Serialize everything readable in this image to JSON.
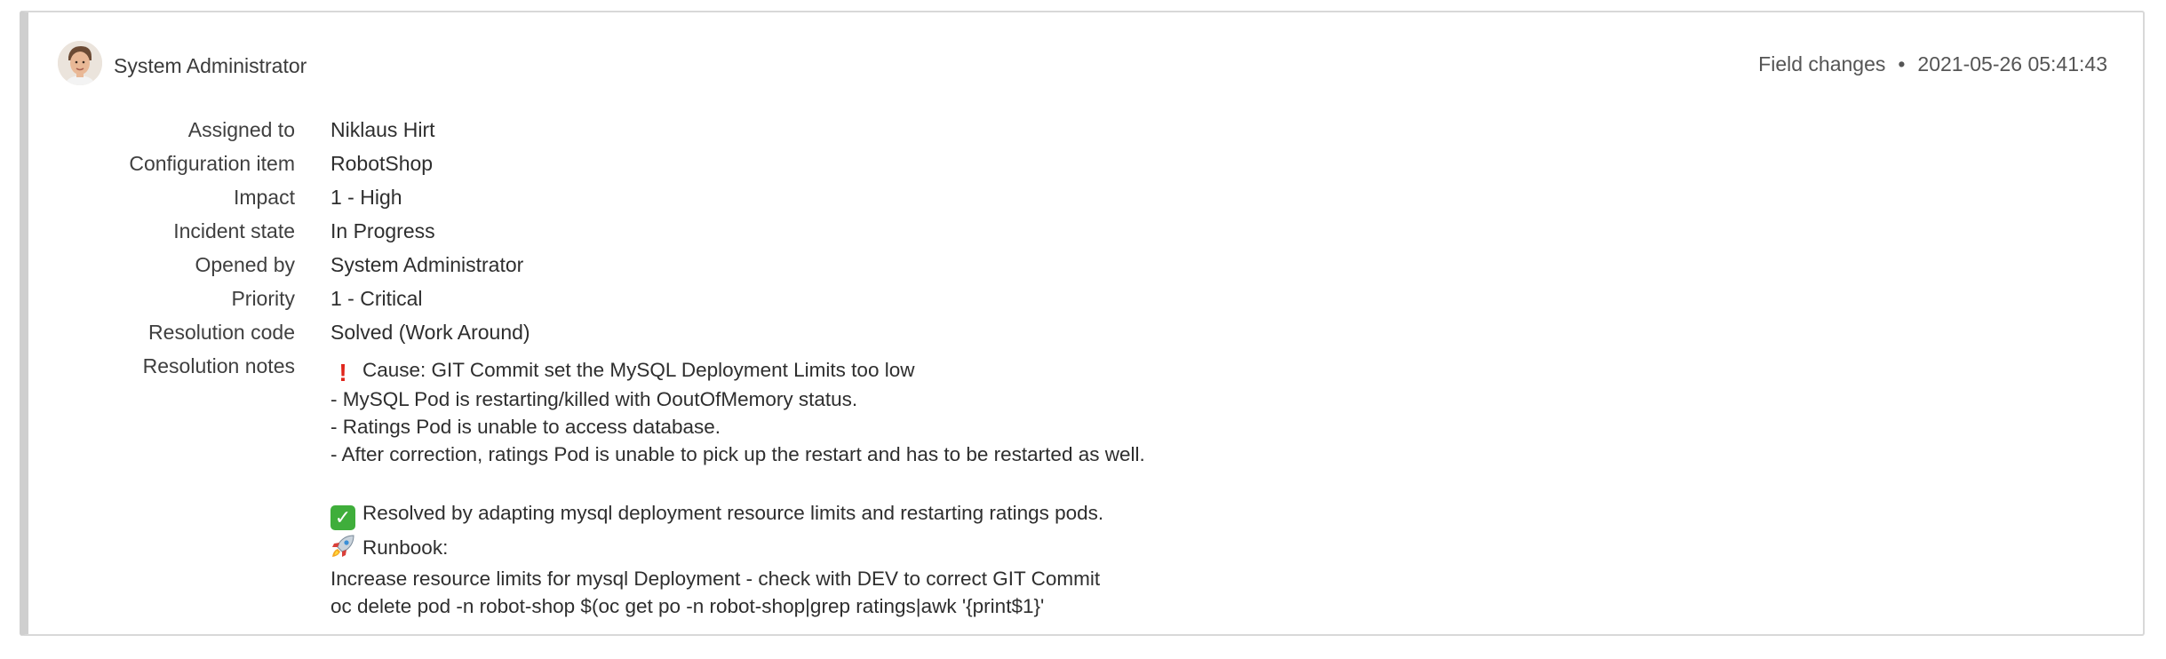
{
  "header": {
    "author": "System Administrator",
    "activity_type": "Field changes",
    "separator": "•",
    "timestamp": "2021-05-26 05:41:43"
  },
  "fields": [
    {
      "label": "Assigned to",
      "value": "Niklaus Hirt"
    },
    {
      "label": "Configuration item",
      "value": "RobotShop"
    },
    {
      "label": "Impact",
      "value": "1 - High"
    },
    {
      "label": "Incident state",
      "value": "In Progress"
    },
    {
      "label": "Opened by",
      "value": "System Administrator"
    },
    {
      "label": "Priority",
      "value": "1 - Critical"
    },
    {
      "label": "Resolution code",
      "value": "Solved (Work Around)"
    }
  ],
  "resolution_notes": {
    "label": "Resolution notes",
    "cause": "Cause: GIT Commit set the MySQL Deployment Limits too low",
    "cause_details": [
      "- MySQL Pod is restarting/killed with OoutOfMemory status.",
      "- Ratings Pod is unable to access database.",
      "- After correction, ratings Pod is unable to pick up the restart and has to be restarted as well."
    ],
    "resolved": "Resolved by adapting mysql deployment resource limits and restarting ratings pods.",
    "runbook_title": "Runbook:",
    "runbook_steps": [
      "Increase resource limits for mysql Deployment - check with DEV to correct GIT Commit",
      "oc delete pod -n robot-shop $(oc get po -n robot-shop|grep ratings|awk '{print$1}'"
    ]
  },
  "icons": {
    "avatar": "user-avatar",
    "cause": "exclamation-icon",
    "resolved": "check-mark-icon",
    "runbook": "rocket-icon"
  },
  "colors": {
    "card_border": "#d8d8d8",
    "card_accent": "#cfcfcf",
    "text": "#2e2e2e",
    "exclamation": "#e0251b",
    "check": "#3fae3b"
  }
}
